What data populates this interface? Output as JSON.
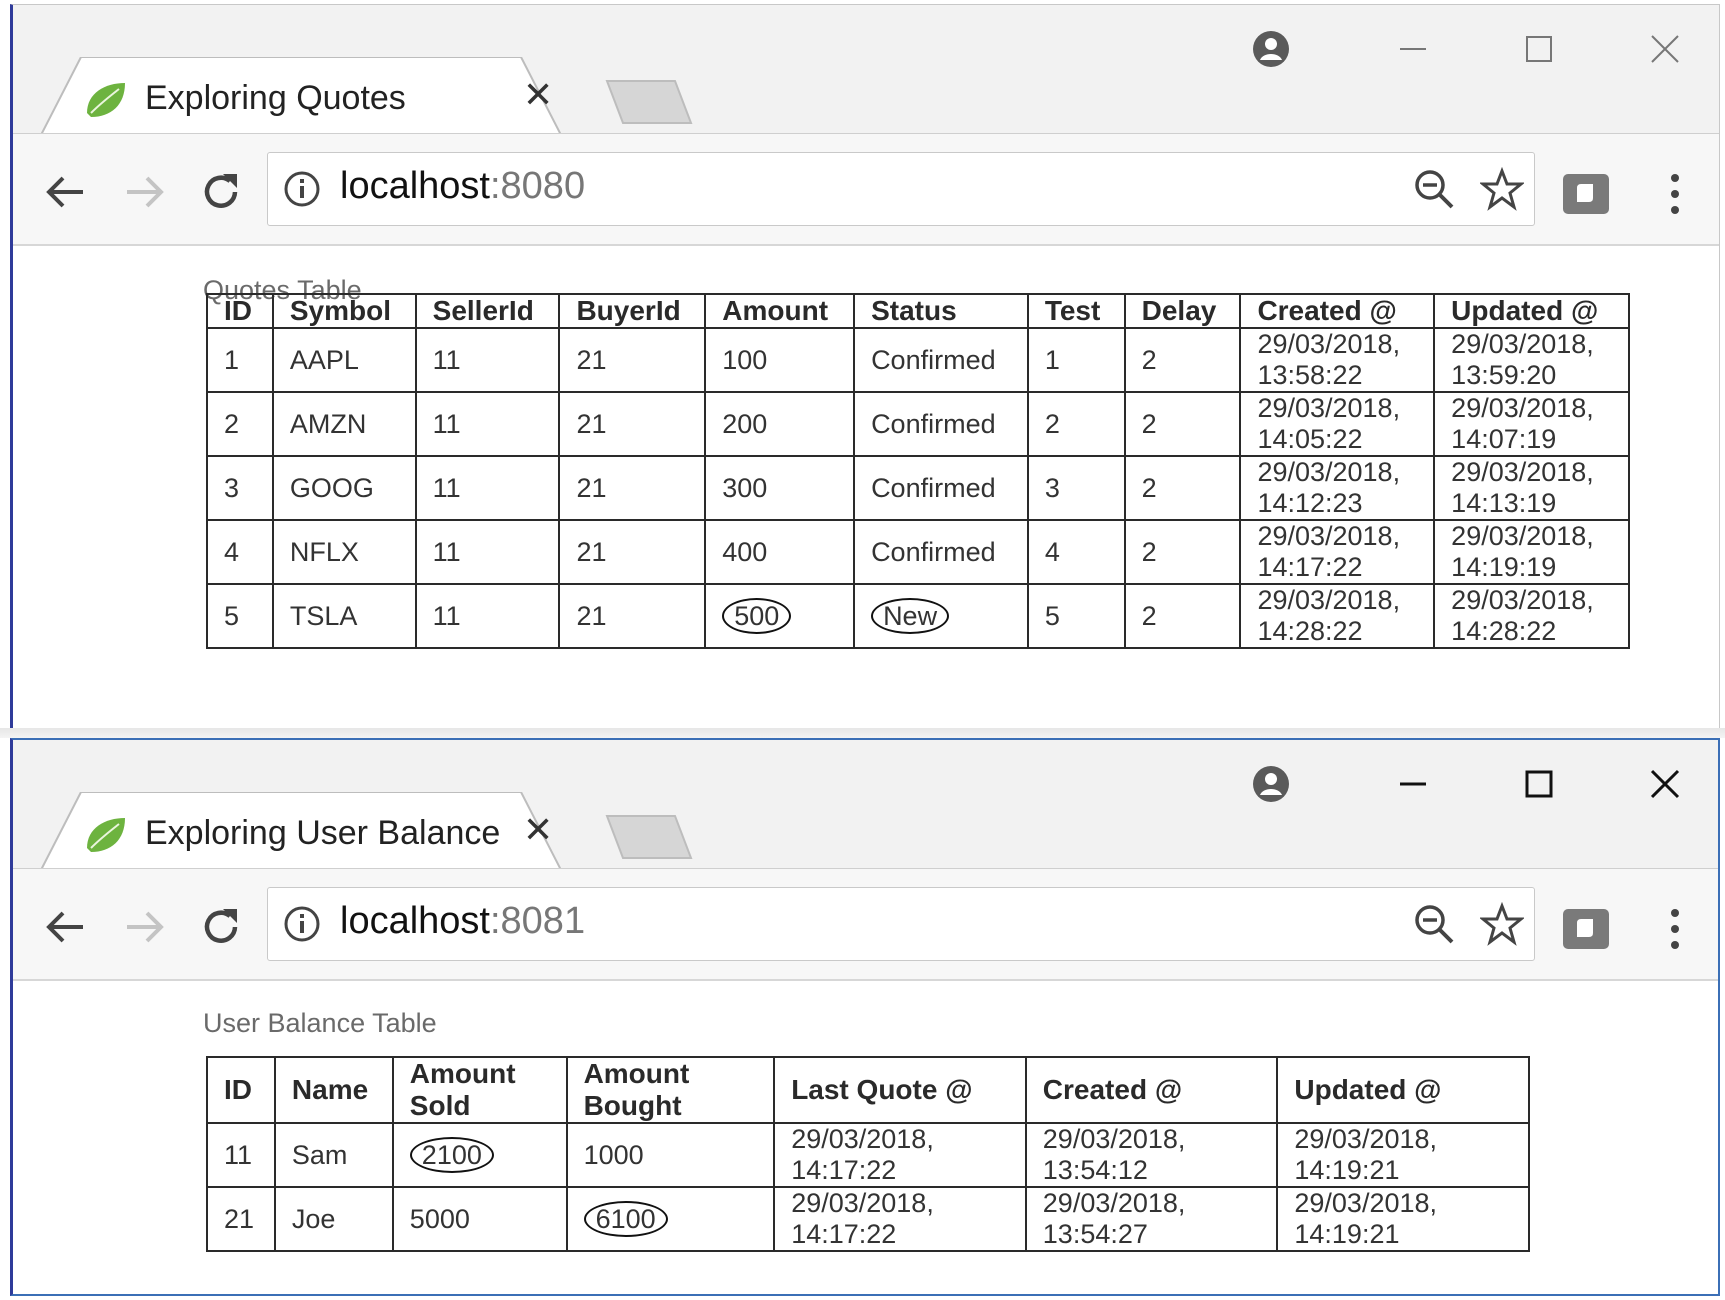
{
  "windows": [
    {
      "tab_title": "Exploring Quotes",
      "tab_close": "✕",
      "url_host": "localhost",
      "url_port": ":8080",
      "caption": "Quotes Table",
      "table": {
        "headers": [
          "ID",
          "Symbol",
          "SellerId",
          "BuyerId",
          "Amount",
          "Status",
          "Test",
          "Delay",
          "Created @",
          "Updated @"
        ],
        "rows": [
          [
            "1",
            "AAPL",
            "11",
            "21",
            "100",
            "Confirmed",
            "1",
            "2",
            "29/03/2018, 13:58:22",
            "29/03/2018, 13:59:20"
          ],
          [
            "2",
            "AMZN",
            "11",
            "21",
            "200",
            "Confirmed",
            "2",
            "2",
            "29/03/2018, 14:05:22",
            "29/03/2018, 14:07:19"
          ],
          [
            "3",
            "GOOG",
            "11",
            "21",
            "300",
            "Confirmed",
            "3",
            "2",
            "29/03/2018, 14:12:23",
            "29/03/2018, 14:13:19"
          ],
          [
            "4",
            "NFLX",
            "11",
            "21",
            "400",
            "Confirmed",
            "4",
            "2",
            "29/03/2018, 14:17:22",
            "29/03/2018, 14:19:19"
          ],
          [
            "5",
            "TSLA",
            "11",
            "21",
            "500",
            "New",
            "5",
            "2",
            "29/03/2018, 14:28:22",
            "29/03/2018, 14:28:22"
          ]
        ]
      }
    },
    {
      "tab_title": "Exploring User Balance",
      "tab_close": "✕",
      "url_host": "localhost",
      "url_port": ":8081",
      "caption": "User Balance Table",
      "table": {
        "headers": [
          "ID",
          "Name",
          "Amount Sold",
          "Amount Bought",
          "Last Quote @",
          "Created @",
          "Updated @"
        ],
        "rows": [
          [
            "11",
            "Sam",
            "2100",
            "1000",
            "29/03/2018, 14:17:22",
            "29/03/2018, 13:54:12",
            "29/03/2018, 14:19:21"
          ],
          [
            "21",
            "Joe",
            "5000",
            "6100",
            "29/03/2018, 14:17:22",
            "29/03/2018, 13:54:27",
            "29/03/2018, 14:19:21"
          ]
        ]
      }
    }
  ],
  "highlighted_cells": [
    "500",
    "New",
    "2100",
    "6100"
  ],
  "icons": [
    "spring-leaf-icon",
    "profile-icon",
    "minimize-icon",
    "maximize-icon",
    "close-icon",
    "back-arrow-icon",
    "forward-arrow-icon",
    "reload-icon",
    "info-icon",
    "zoom-out-icon",
    "star-icon",
    "extension-icon",
    "menu-icon"
  ],
  "colors": {
    "favicon": "#6db33f",
    "window_border_active": "#3b6fb6",
    "port_text": "#777777"
  }
}
